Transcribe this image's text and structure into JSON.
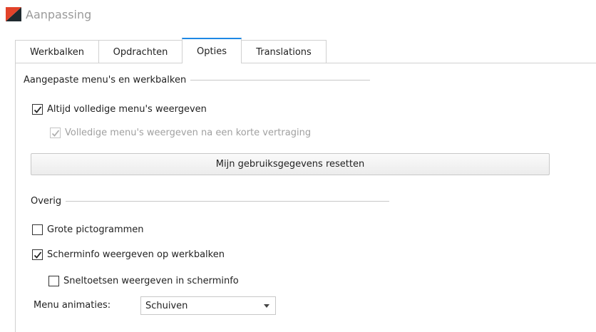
{
  "window": {
    "title": "Aanpassing",
    "logo_icon": "app-logo-icon"
  },
  "tabs": [
    {
      "label": "Werkbalken",
      "active": false
    },
    {
      "label": "Opdrachten",
      "active": false
    },
    {
      "label": "Opties",
      "active": true
    },
    {
      "label": "Translations",
      "active": false
    }
  ],
  "menus_group": {
    "header": "Aangepaste menu's en werkbalken",
    "always_full_menus": {
      "label": "Altijd volledige menu's weergeven",
      "checked": true,
      "enabled": true
    },
    "full_menus_after_delay": {
      "label": "Volledige menu's weergeven na een korte vertraging",
      "checked": true,
      "enabled": false
    },
    "reset_button_label": "Mijn gebruiksgegevens resetten"
  },
  "other_group": {
    "header": "Overig",
    "large_icons": {
      "label": "Grote pictogrammen",
      "checked": false,
      "enabled": true
    },
    "show_screentips": {
      "label": "Scherminfo weergeven op werkbalken",
      "checked": true,
      "enabled": true
    },
    "show_shortcuts_in_screentips": {
      "label": "Sneltoetsen weergeven in scherminfo",
      "checked": false,
      "enabled": true
    },
    "menu_animations": {
      "label": "Menu animaties:",
      "value": "Schuiven"
    }
  },
  "colors": {
    "active_tab_accent": "#1e88e5",
    "disabled_text": "#a0a0a0",
    "logo_red": "#e2432a",
    "logo_dark": "#1f2a2f"
  }
}
